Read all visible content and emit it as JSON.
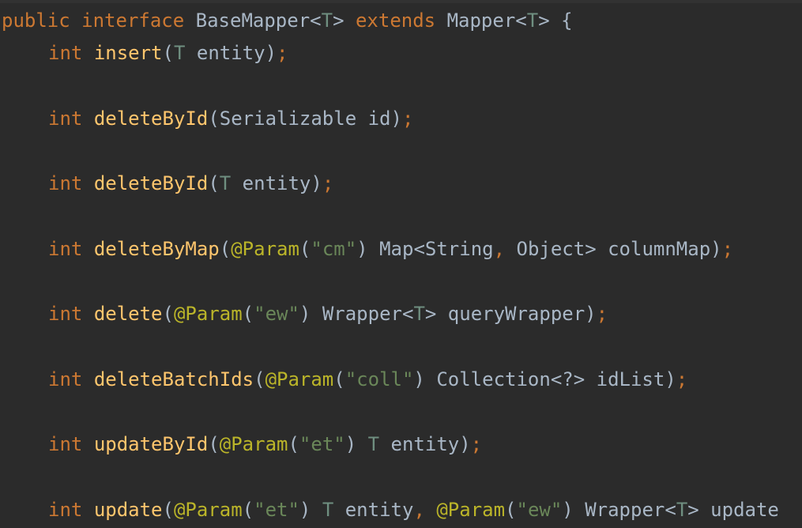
{
  "editor": {
    "lines": [
      {
        "indent": false,
        "tokens": [
          {
            "t": "public",
            "c": "kw"
          },
          {
            "t": " ",
            "c": "pn"
          },
          {
            "t": "interface",
            "c": "kw"
          },
          {
            "t": " ",
            "c": "pn"
          },
          {
            "t": "BaseMapper",
            "c": "tp"
          },
          {
            "t": "<",
            "c": "pn"
          },
          {
            "t": "T",
            "c": "tpv"
          },
          {
            "t": ">",
            "c": "pn"
          },
          {
            "t": " ",
            "c": "pn"
          },
          {
            "t": "extends",
            "c": "kw"
          },
          {
            "t": " ",
            "c": "pn"
          },
          {
            "t": "Mapper",
            "c": "tp"
          },
          {
            "t": "<",
            "c": "pn"
          },
          {
            "t": "T",
            "c": "tpv"
          },
          {
            "t": "> {",
            "c": "pn"
          }
        ]
      },
      {
        "indent": true,
        "tokens": [
          {
            "t": "int",
            "c": "kw"
          },
          {
            "t": " ",
            "c": "pn"
          },
          {
            "t": "insert",
            "c": "fn"
          },
          {
            "t": "(",
            "c": "pn"
          },
          {
            "t": "T",
            "c": "tpv"
          },
          {
            "t": " entity)",
            "c": "pn"
          },
          {
            "t": ";",
            "c": "sc"
          }
        ]
      },
      {
        "indent": true,
        "tokens": [
          {
            "t": "int",
            "c": "kw"
          },
          {
            "t": " ",
            "c": "pn"
          },
          {
            "t": "deleteById",
            "c": "fn"
          },
          {
            "t": "(",
            "c": "pn"
          },
          {
            "t": "Serializable",
            "c": "tp"
          },
          {
            "t": " id)",
            "c": "pn"
          },
          {
            "t": ";",
            "c": "sc"
          }
        ]
      },
      {
        "indent": true,
        "tokens": [
          {
            "t": "int",
            "c": "kw"
          },
          {
            "t": " ",
            "c": "pn"
          },
          {
            "t": "deleteById",
            "c": "fn"
          },
          {
            "t": "(",
            "c": "pn"
          },
          {
            "t": "T",
            "c": "tpv"
          },
          {
            "t": " entity)",
            "c": "pn"
          },
          {
            "t": ";",
            "c": "sc"
          }
        ]
      },
      {
        "indent": true,
        "tokens": [
          {
            "t": "int",
            "c": "kw"
          },
          {
            "t": " ",
            "c": "pn"
          },
          {
            "t": "deleteByMap",
            "c": "fn"
          },
          {
            "t": "(",
            "c": "pn"
          },
          {
            "t": "@Param",
            "c": "ann"
          },
          {
            "t": "(",
            "c": "pn"
          },
          {
            "t": "\"cm\"",
            "c": "str"
          },
          {
            "t": ") ",
            "c": "pn"
          },
          {
            "t": "Map",
            "c": "tp"
          },
          {
            "t": "<",
            "c": "pn"
          },
          {
            "t": "String",
            "c": "tp"
          },
          {
            "t": ",",
            "c": "sc"
          },
          {
            "t": " ",
            "c": "pn"
          },
          {
            "t": "Object",
            "c": "tp"
          },
          {
            "t": "> columnMap)",
            "c": "pn"
          },
          {
            "t": ";",
            "c": "sc"
          }
        ]
      },
      {
        "indent": true,
        "tokens": [
          {
            "t": "int",
            "c": "kw"
          },
          {
            "t": " ",
            "c": "pn"
          },
          {
            "t": "delete",
            "c": "fn"
          },
          {
            "t": "(",
            "c": "pn"
          },
          {
            "t": "@Param",
            "c": "ann"
          },
          {
            "t": "(",
            "c": "pn"
          },
          {
            "t": "\"ew\"",
            "c": "str"
          },
          {
            "t": ") ",
            "c": "pn"
          },
          {
            "t": "Wrapper",
            "c": "tp"
          },
          {
            "t": "<",
            "c": "pn"
          },
          {
            "t": "T",
            "c": "tpv"
          },
          {
            "t": "> queryWrapper)",
            "c": "pn"
          },
          {
            "t": ";",
            "c": "sc"
          }
        ]
      },
      {
        "indent": true,
        "tokens": [
          {
            "t": "int",
            "c": "kw"
          },
          {
            "t": " ",
            "c": "pn"
          },
          {
            "t": "deleteBatchIds",
            "c": "fn"
          },
          {
            "t": "(",
            "c": "pn"
          },
          {
            "t": "@Param",
            "c": "ann"
          },
          {
            "t": "(",
            "c": "pn"
          },
          {
            "t": "\"coll\"",
            "c": "str"
          },
          {
            "t": ") ",
            "c": "pn"
          },
          {
            "t": "Collection",
            "c": "tp"
          },
          {
            "t": "<?> idList)",
            "c": "pn"
          },
          {
            "t": ";",
            "c": "sc"
          }
        ]
      },
      {
        "indent": true,
        "tokens": [
          {
            "t": "int",
            "c": "kw"
          },
          {
            "t": " ",
            "c": "pn"
          },
          {
            "t": "updateById",
            "c": "fn"
          },
          {
            "t": "(",
            "c": "pn"
          },
          {
            "t": "@Param",
            "c": "ann"
          },
          {
            "t": "(",
            "c": "pn"
          },
          {
            "t": "\"et\"",
            "c": "str"
          },
          {
            "t": ") ",
            "c": "pn"
          },
          {
            "t": "T",
            "c": "tpv"
          },
          {
            "t": " entity)",
            "c": "pn"
          },
          {
            "t": ";",
            "c": "sc"
          }
        ]
      },
      {
        "indent": true,
        "tokens": [
          {
            "t": "int",
            "c": "kw"
          },
          {
            "t": " ",
            "c": "pn"
          },
          {
            "t": "update",
            "c": "fn"
          },
          {
            "t": "(",
            "c": "pn"
          },
          {
            "t": "@Param",
            "c": "ann"
          },
          {
            "t": "(",
            "c": "pn"
          },
          {
            "t": "\"et\"",
            "c": "str"
          },
          {
            "t": ") ",
            "c": "pn"
          },
          {
            "t": "T",
            "c": "tpv"
          },
          {
            "t": " entity",
            "c": "pn"
          },
          {
            "t": ",",
            "c": "sc"
          },
          {
            "t": " ",
            "c": "pn"
          },
          {
            "t": "@Param",
            "c": "ann"
          },
          {
            "t": "(",
            "c": "pn"
          },
          {
            "t": "\"ew\"",
            "c": "str"
          },
          {
            "t": ") ",
            "c": "pn"
          },
          {
            "t": "Wrapper",
            "c": "tp"
          },
          {
            "t": "<",
            "c": "pn"
          },
          {
            "t": "T",
            "c": "tpv"
          },
          {
            "t": "> update",
            "c": "pn"
          }
        ]
      }
    ]
  },
  "colors": {
    "background": "#2b2b2b",
    "keyword": "#cc7832",
    "method": "#ffc66d",
    "type": "#a9b7c6",
    "type_parameter": "#6f8f80",
    "annotation": "#bbb529",
    "string": "#6a8759",
    "punctuation": "#a9b7c6"
  }
}
